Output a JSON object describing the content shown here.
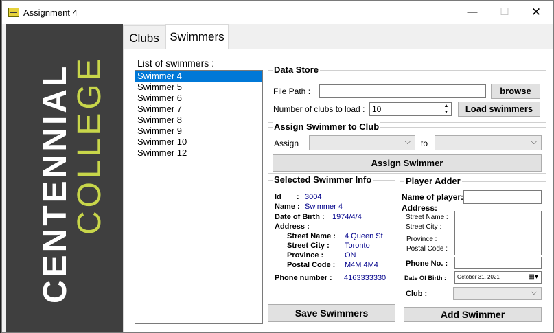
{
  "window": {
    "title": "Assignment 4",
    "minimize": "—",
    "maximize": "☐",
    "close": "✕"
  },
  "sidebar": {
    "logo_line1": "CENTENNIAL",
    "logo_line2": "COLLEGE"
  },
  "tabs": [
    {
      "label": "Clubs"
    },
    {
      "label": "Swimmers"
    }
  ],
  "swimmers_list": {
    "title": "List of swimmers :",
    "items": [
      "Swimmer 4",
      "Swimmer 5",
      "Swimmer 6",
      "Swimmer 7",
      "Swimmer 8",
      "Swimmer 9",
      "Swimmer 10",
      "Swimmer 12"
    ],
    "selected": "Swimmer 4"
  },
  "data_store": {
    "title": "Data Store",
    "file_path_label": "File Path :",
    "file_path_value": "",
    "browse": "browse",
    "num_clubs_label": "Number of clubs to load :",
    "num_clubs_value": "10",
    "load": "Load swimmers"
  },
  "assign": {
    "title": "Assign Swimmer to Club",
    "assign_label": "Assign",
    "to_label": "to",
    "button": "Assign Swimmer"
  },
  "selected_info": {
    "title": "Selected Swimmer Info",
    "id_label": "Id",
    "id_sep": ":",
    "id": "3004",
    "name_label": "Name :",
    "name": "Swimmer 4",
    "dob_label": "Date of Birth :",
    "dob": "1974/4/4",
    "address_label": "Address :",
    "street_label": "Street Name :",
    "street": "4 Queen St",
    "city_label": "Street City :",
    "city": "Toronto",
    "province_label": "Province :",
    "province": "ON",
    "postal_label": "Postal Code :",
    "postal": "M4M 4M4",
    "phone_label": "Phone number :",
    "phone": "4163333330"
  },
  "save_button": "Save Swimmers",
  "player_adder": {
    "title": "Player Adder",
    "name_label": "Name of player:",
    "address_label": "Address:",
    "street_label": "Street Name :",
    "city_label": "Street City :",
    "province_label": "Province :",
    "postal_label": "Postal Code :",
    "phone_label": "Phone No. :",
    "dob_label": "Date Of Birth :",
    "dob_value": "October    31, 2021",
    "club_label": "Club :",
    "add_button": "Add Swimmer"
  }
}
